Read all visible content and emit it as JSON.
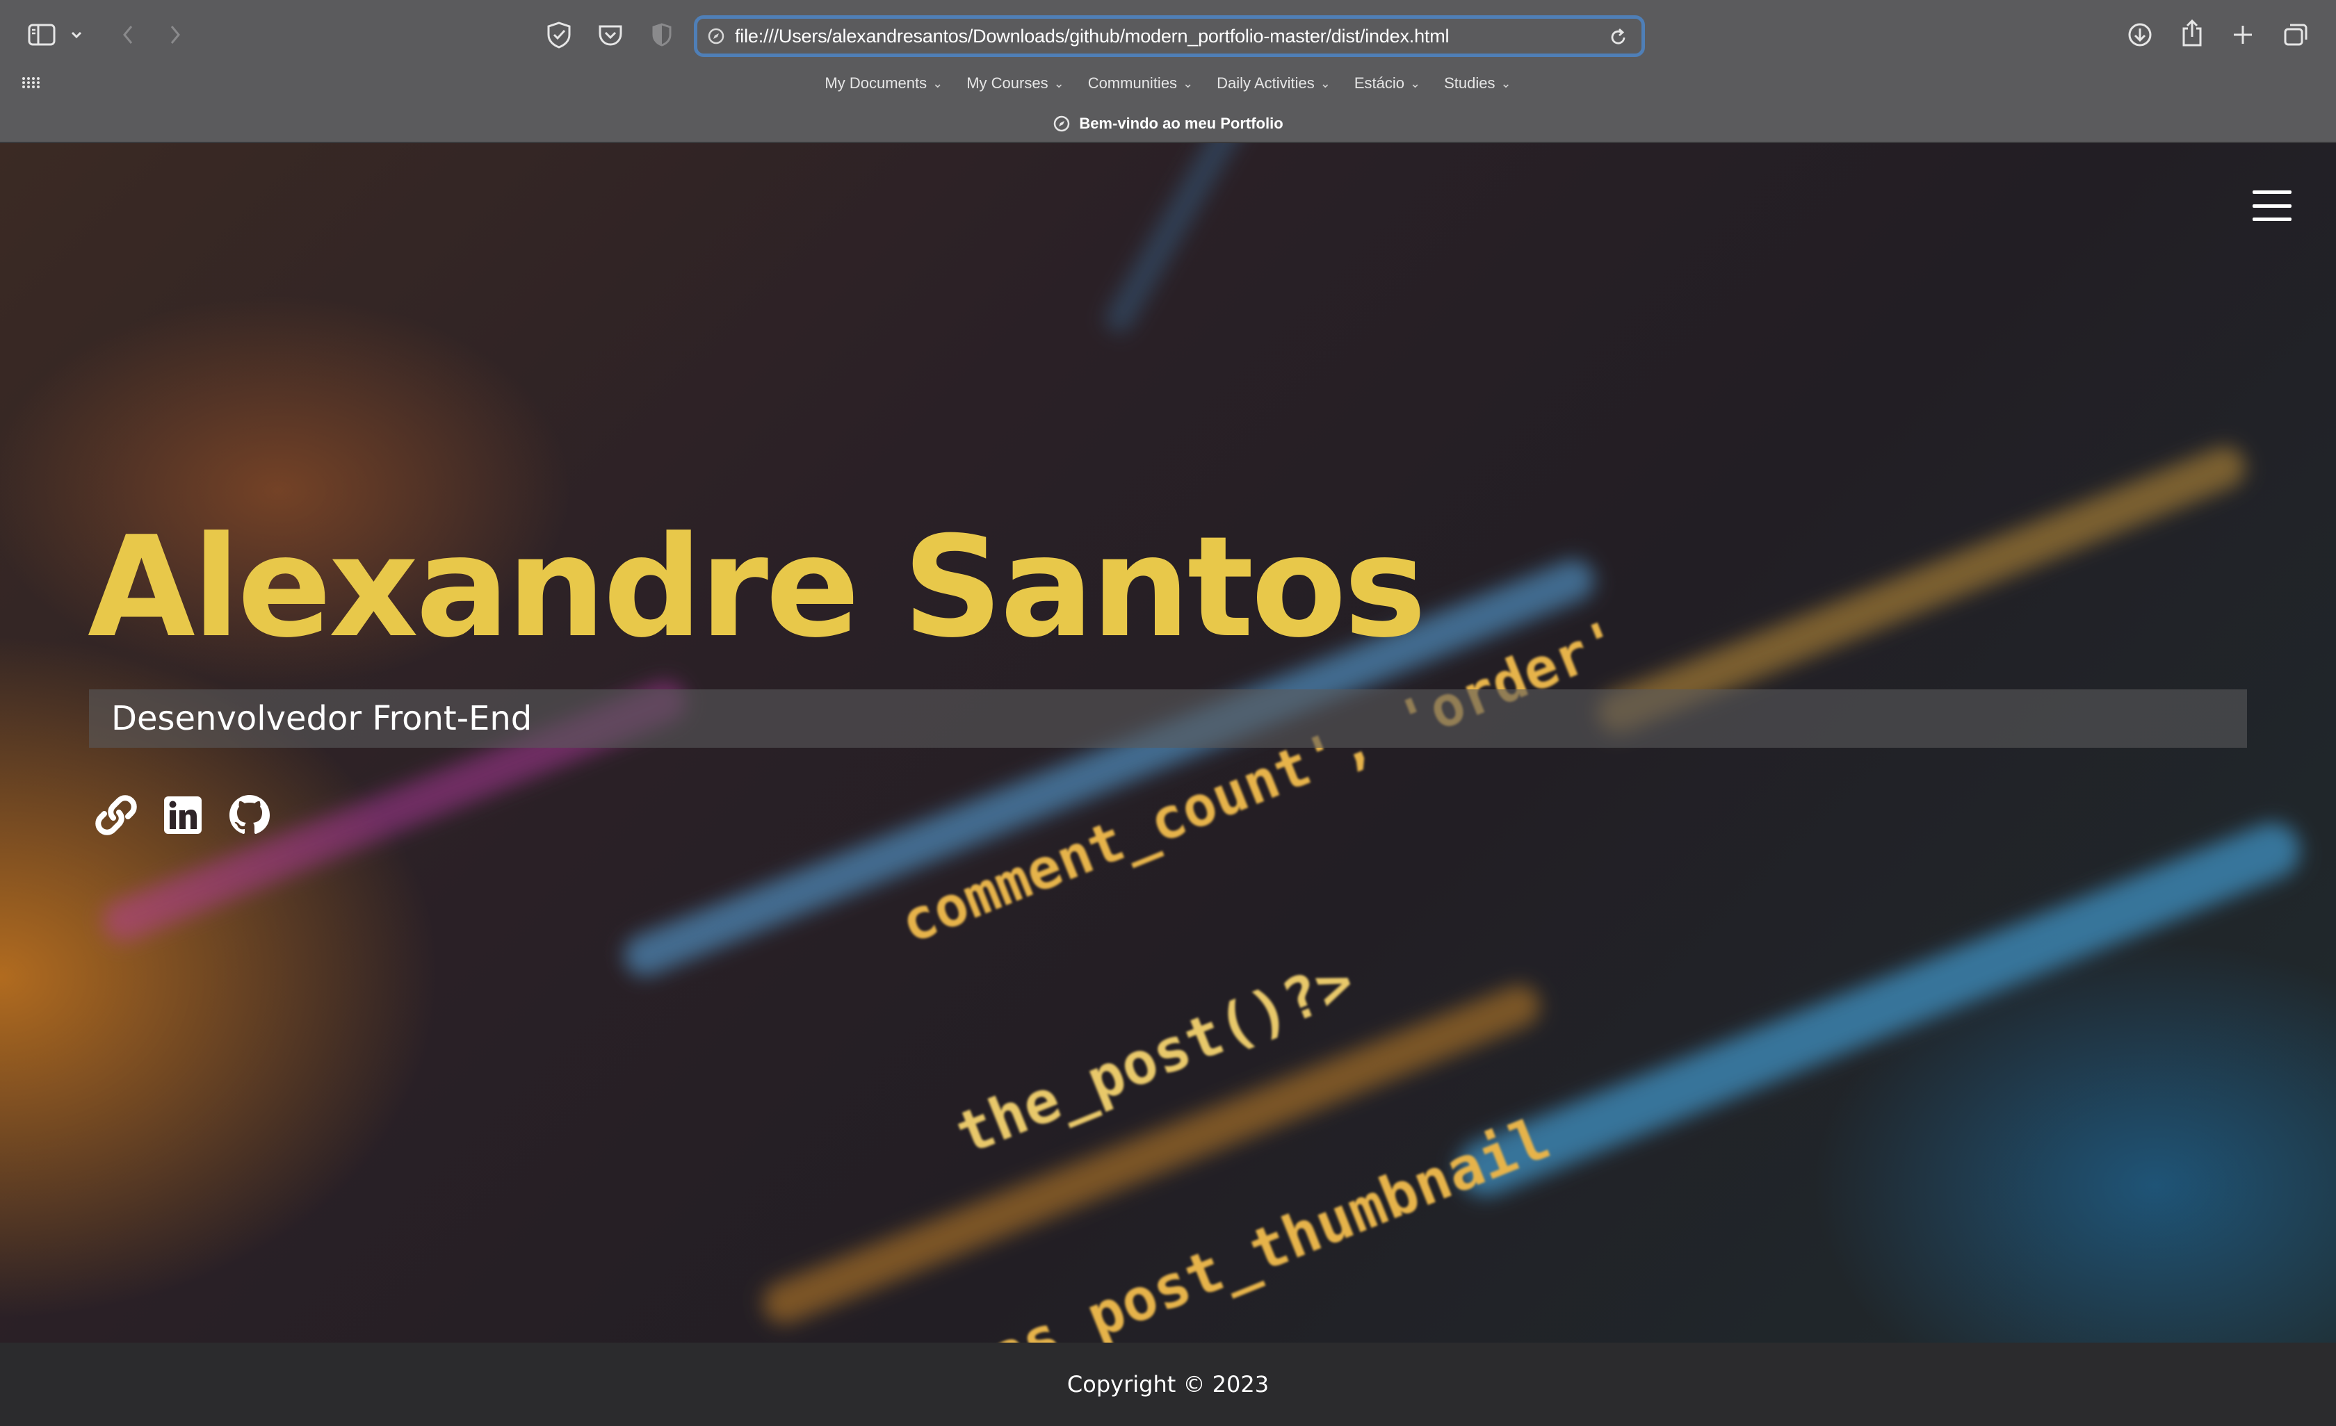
{
  "browser": {
    "url": "file:///Users/alexandresantos/Downloads/github/modern_portfolio-master/dist/index.html",
    "tab_title": "Bem-vindo ao meu Portfolio",
    "bookmarks": [
      {
        "label": "My Documents"
      },
      {
        "label": "My Courses"
      },
      {
        "label": "Communities"
      },
      {
        "label": "Daily Activities"
      },
      {
        "label": "Estácio"
      },
      {
        "label": "Studies"
      }
    ],
    "icons": {
      "sidebar": "sidebar-icon",
      "back": "chevron-left-icon",
      "forward": "chevron-right-icon",
      "shield": "shield-check-icon",
      "pocket": "pocket-icon",
      "privacy": "half-shield-icon",
      "reload": "reload-icon",
      "download": "download-icon",
      "share": "share-icon",
      "new_tab": "plus-icon",
      "tabs": "tabs-overview-icon",
      "grid": "grid-icon"
    }
  },
  "page": {
    "name": "Alexandre Santos",
    "role": "Desenvolvedor Front-End",
    "social_links": [
      {
        "icon": "link-icon"
      },
      {
        "icon": "linkedin-icon"
      },
      {
        "icon": "github-icon"
      }
    ],
    "footer": "Copyright © 2023",
    "colors": {
      "name": "#e8c84a",
      "footer_bg": "#2b2b2d",
      "chrome_bg": "#5b5b5d",
      "url_focus": "#4f7fb7"
    }
  }
}
